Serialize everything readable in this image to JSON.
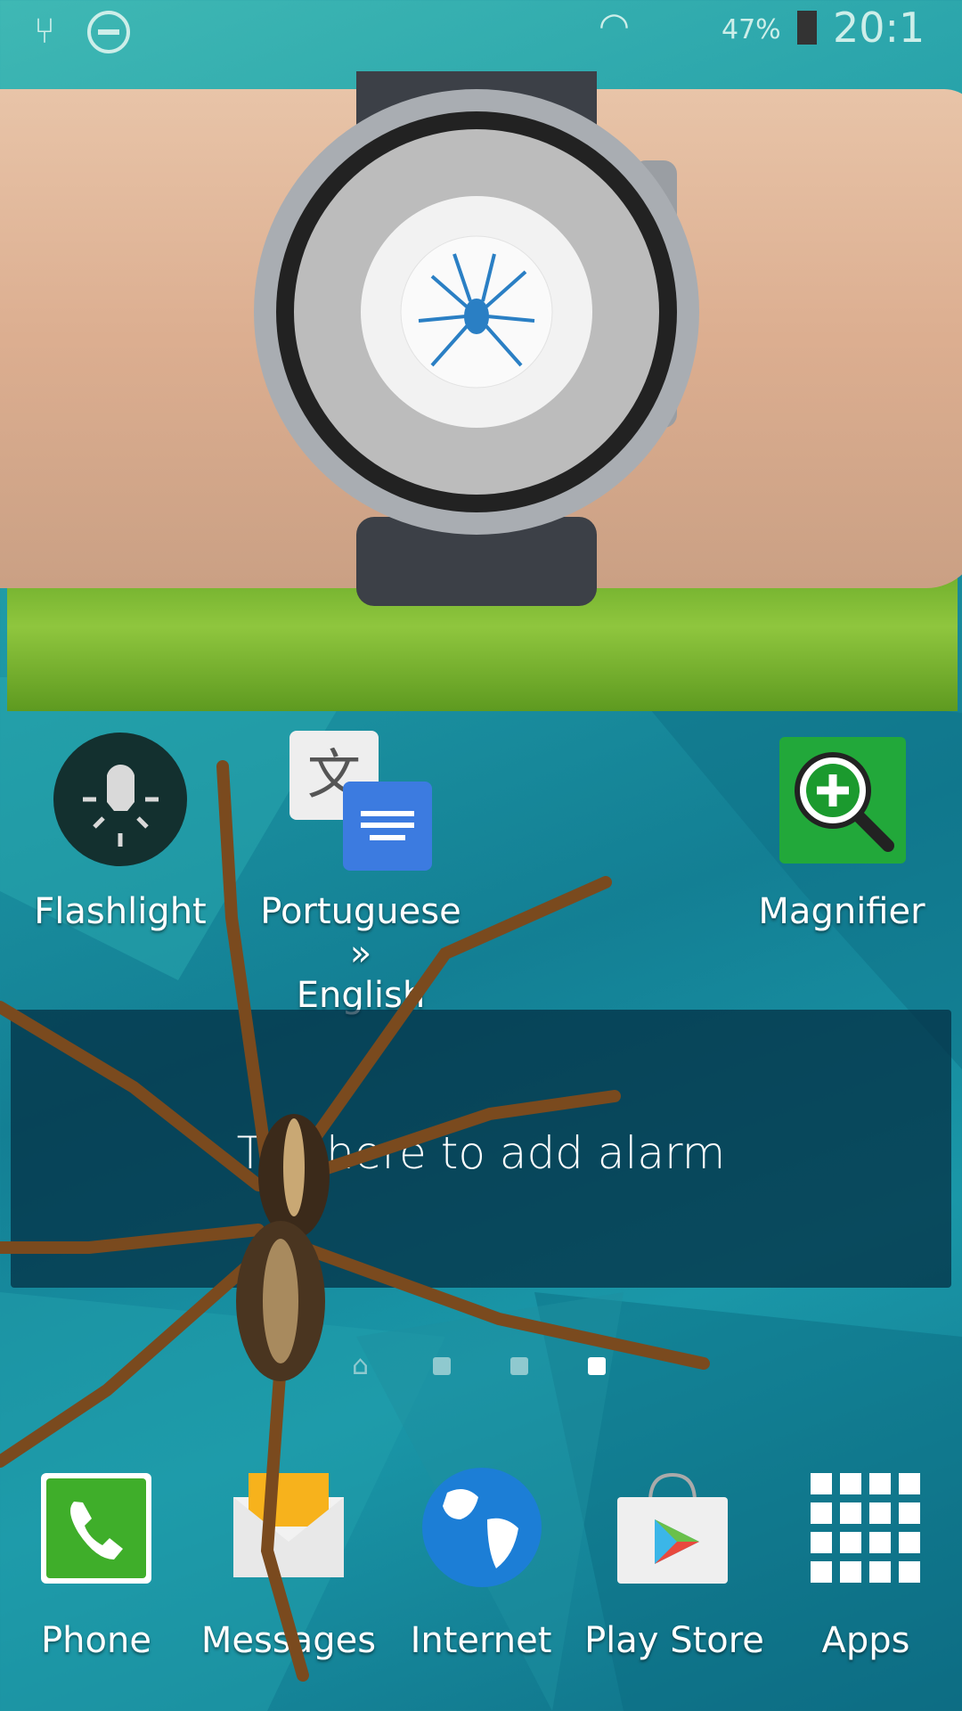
{
  "status_bar": {
    "icons": [
      "usb-icon",
      "do-not-disturb-icon",
      "wifi-icon",
      "signal-icon",
      "battery-charging-icon"
    ],
    "battery": "47%",
    "time": "20:1"
  },
  "overlay": {
    "description_icons": [
      "smartwatch-icon",
      "spider-icon"
    ]
  },
  "apps": [
    {
      "label": "Flashlight",
      "icon": "flashlight-icon"
    },
    {
      "label_line1": "Portuguese »",
      "label_line2": "English",
      "icon": "translate-icon"
    },
    {
      "label": "Magnifier",
      "icon": "magnifier-icon"
    }
  ],
  "widget": {
    "text": "Tap here to add alarm"
  },
  "page_indicator": {
    "pages": 4,
    "current": 4
  },
  "dock": [
    {
      "label": "Phone",
      "icon": "phone-icon"
    },
    {
      "label": "Messages",
      "icon": "messages-icon"
    },
    {
      "label": "Internet",
      "icon": "globe-icon"
    },
    {
      "label": "Play Store",
      "icon": "play-store-icon"
    },
    {
      "label": "Apps",
      "icon": "apps-grid-icon"
    }
  ],
  "colors": {
    "accent": "#1f9aa6",
    "phone": "#3fae2a",
    "magnifier": "#22a83a"
  }
}
